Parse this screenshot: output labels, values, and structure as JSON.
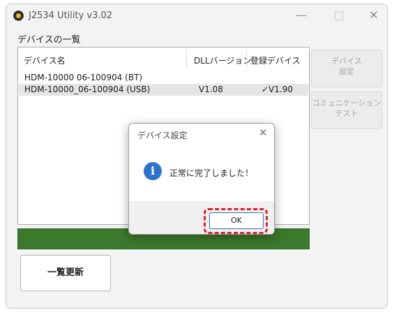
{
  "window": {
    "title": "J2534 Utility v3.02",
    "controls": {
      "minimize": "—",
      "maximize": "□",
      "close": "✕"
    }
  },
  "device_section": {
    "label": "デバイスの一覧",
    "columns": {
      "name": "デバイス名",
      "dll": "DLLバージョン",
      "registered": "登録デバイス"
    },
    "rows": [
      {
        "name": "HDM-10000 06-100904 (BT)",
        "dll": "",
        "registered": ""
      },
      {
        "name": "HDM-10000_06-100904 (USB)",
        "dll": "V1.08",
        "registered": "✓V1.90"
      }
    ]
  },
  "side_buttons": {
    "device_settings": "デバイス\n設定",
    "communication_test": "コミュニケーション\nテスト"
  },
  "refresh_button": "一覧更新",
  "progress": {
    "value": 1.0,
    "color": "#3b7a2c"
  },
  "dialog": {
    "title": "デバイス設定",
    "message": "正常に完了しました！",
    "ok_label": "OK",
    "close": "✕",
    "icon": "info-icon",
    "icon_glyph": "i"
  },
  "colors": {
    "accent": "#2d73c9",
    "highlight": "#d9232a",
    "progress": "#3b7a2c"
  }
}
